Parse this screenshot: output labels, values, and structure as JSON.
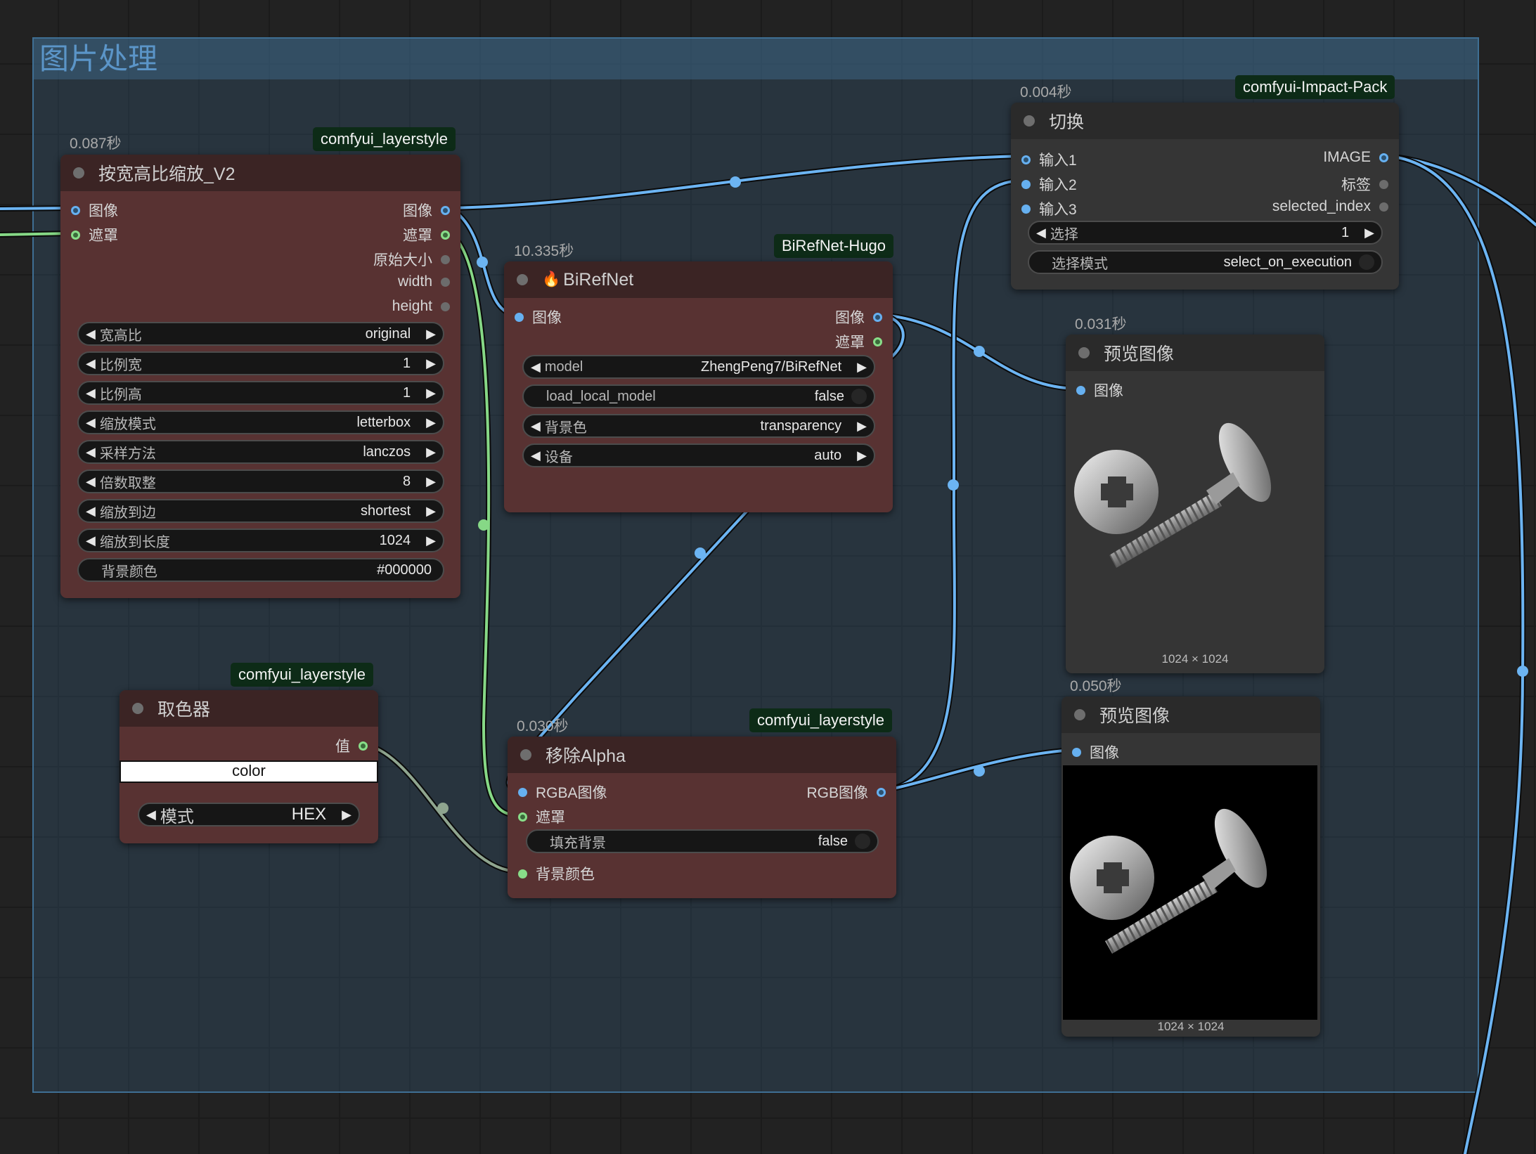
{
  "group": {
    "title": "图片处理"
  },
  "nodes": {
    "resize": {
      "timing": "0.087秒",
      "tag": "comfyui_layerstyle",
      "title": "按宽高比缩放_V2",
      "inputs": [
        "图像",
        "遮罩"
      ],
      "outputs": [
        "图像",
        "遮罩",
        "原始大小",
        "width",
        "height"
      ],
      "widgets": [
        {
          "label": "宽高比",
          "value": "original"
        },
        {
          "label": "比例宽",
          "value": "1"
        },
        {
          "label": "比例高",
          "value": "1"
        },
        {
          "label": "缩放模式",
          "value": "letterbox"
        },
        {
          "label": "采样方法",
          "value": "lanczos"
        },
        {
          "label": "倍数取整",
          "value": "8"
        },
        {
          "label": "缩放到边",
          "value": "shortest"
        },
        {
          "label": "缩放到长度",
          "value": "1024"
        }
      ],
      "text_widget": {
        "label": "背景颜色",
        "value": "#000000"
      }
    },
    "birefnet": {
      "timing": "10.335秒",
      "tag": "BiRefNet-Hugo",
      "title": "BiRefNet",
      "inputs": [
        "图像"
      ],
      "outputs": [
        "图像",
        "遮罩"
      ],
      "widgets": [
        {
          "label": "model",
          "value": "ZhengPeng7/BiRefNet"
        },
        {
          "label": "load_local_model",
          "value": "false"
        },
        {
          "label": "背景色",
          "value": "transparency"
        },
        {
          "label": "设备",
          "value": "auto"
        }
      ]
    },
    "switch": {
      "timing": "0.004秒",
      "tag": "comfyui-Impact-Pack",
      "title": "切换",
      "inputs": [
        "输入1",
        "输入2",
        "输入3"
      ],
      "outputs": [
        "IMAGE",
        "标签",
        "selected_index"
      ],
      "widgets": [
        {
          "label": "选择",
          "value": "1"
        },
        {
          "label": "选择模式",
          "value": "select_on_execution"
        }
      ]
    },
    "preview1": {
      "timing": "0.031秒",
      "title": "预览图像",
      "input": "图像",
      "caption": "1024 × 1024"
    },
    "preview2": {
      "timing": "0.050秒",
      "title": "预览图像",
      "input": "图像",
      "caption": "1024 × 1024"
    },
    "colorpicker": {
      "tag": "comfyui_layerstyle",
      "title": "取色器",
      "output": "值",
      "color_field": "color",
      "mode": {
        "label": "模式",
        "value": "HEX"
      }
    },
    "removealpha": {
      "timing": "0.030秒",
      "tag": "comfyui_layerstyle",
      "title": "移除Alpha",
      "inputs": [
        "RGBA图像",
        "遮罩"
      ],
      "outputs": [
        "RGB图像"
      ],
      "toggle": {
        "label": "填充背景",
        "value": "false"
      },
      "extra_input": "背景颜色"
    }
  },
  "colors": {
    "image_link": "#6cb4f2",
    "mask_link": "#86d886",
    "node_body": "#583232",
    "node_title": "#3b2424",
    "tag_bg": "#0d2b17",
    "group_title": "#5b95c8"
  }
}
